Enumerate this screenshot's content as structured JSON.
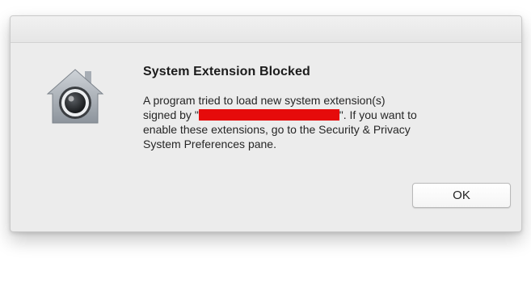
{
  "dialog": {
    "title": "System Extension Blocked",
    "message": {
      "line1": "A program tried to load new system extension(s)",
      "line2_prefix": "signed by \"",
      "line2_suffix": "\".  If you want to",
      "line3": "enable these extensions, go to the Security & Privacy",
      "line4": "System Preferences pane."
    },
    "ok_label": "OK",
    "icon": "gatekeeper-house-lock-icon"
  },
  "colors": {
    "dialog_bg": "#ececec",
    "redaction": "#e60b0b",
    "text": "#262626"
  }
}
